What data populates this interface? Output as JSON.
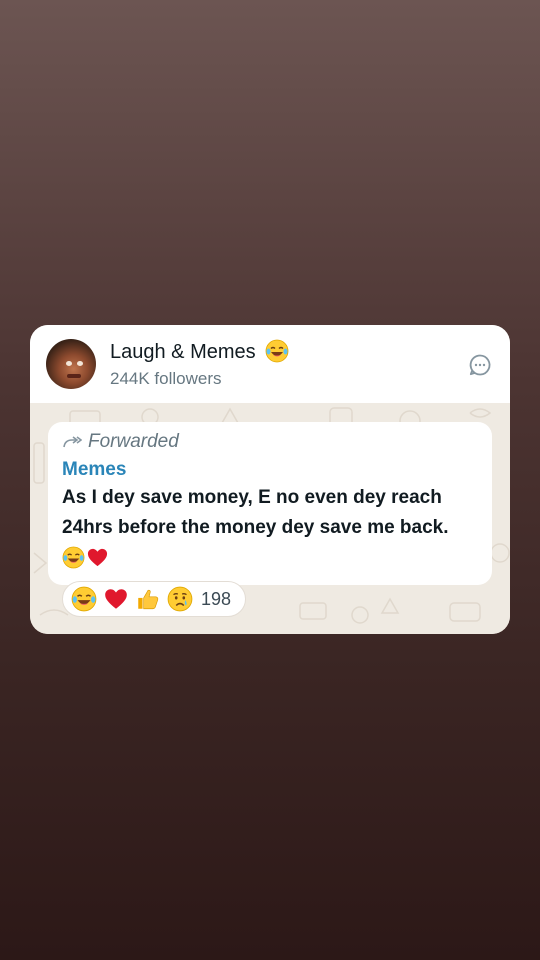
{
  "channel": {
    "name": "Laugh & Memes",
    "followers": "244K followers"
  },
  "message": {
    "forwarded_label": "Forwarded",
    "sender": "Memes",
    "line1": "As I dey save money, E no even dey reach",
    "line2": "24hrs before the money dey save me back."
  },
  "reactions": {
    "count": "198",
    "emojis": [
      "tears-of-joy",
      "red-heart",
      "thumbs-up",
      "crying-face"
    ]
  },
  "colors": {
    "accent_link": "#2a85b8",
    "card_bg": "#ffffff",
    "wallpaper": "#efeae2"
  }
}
